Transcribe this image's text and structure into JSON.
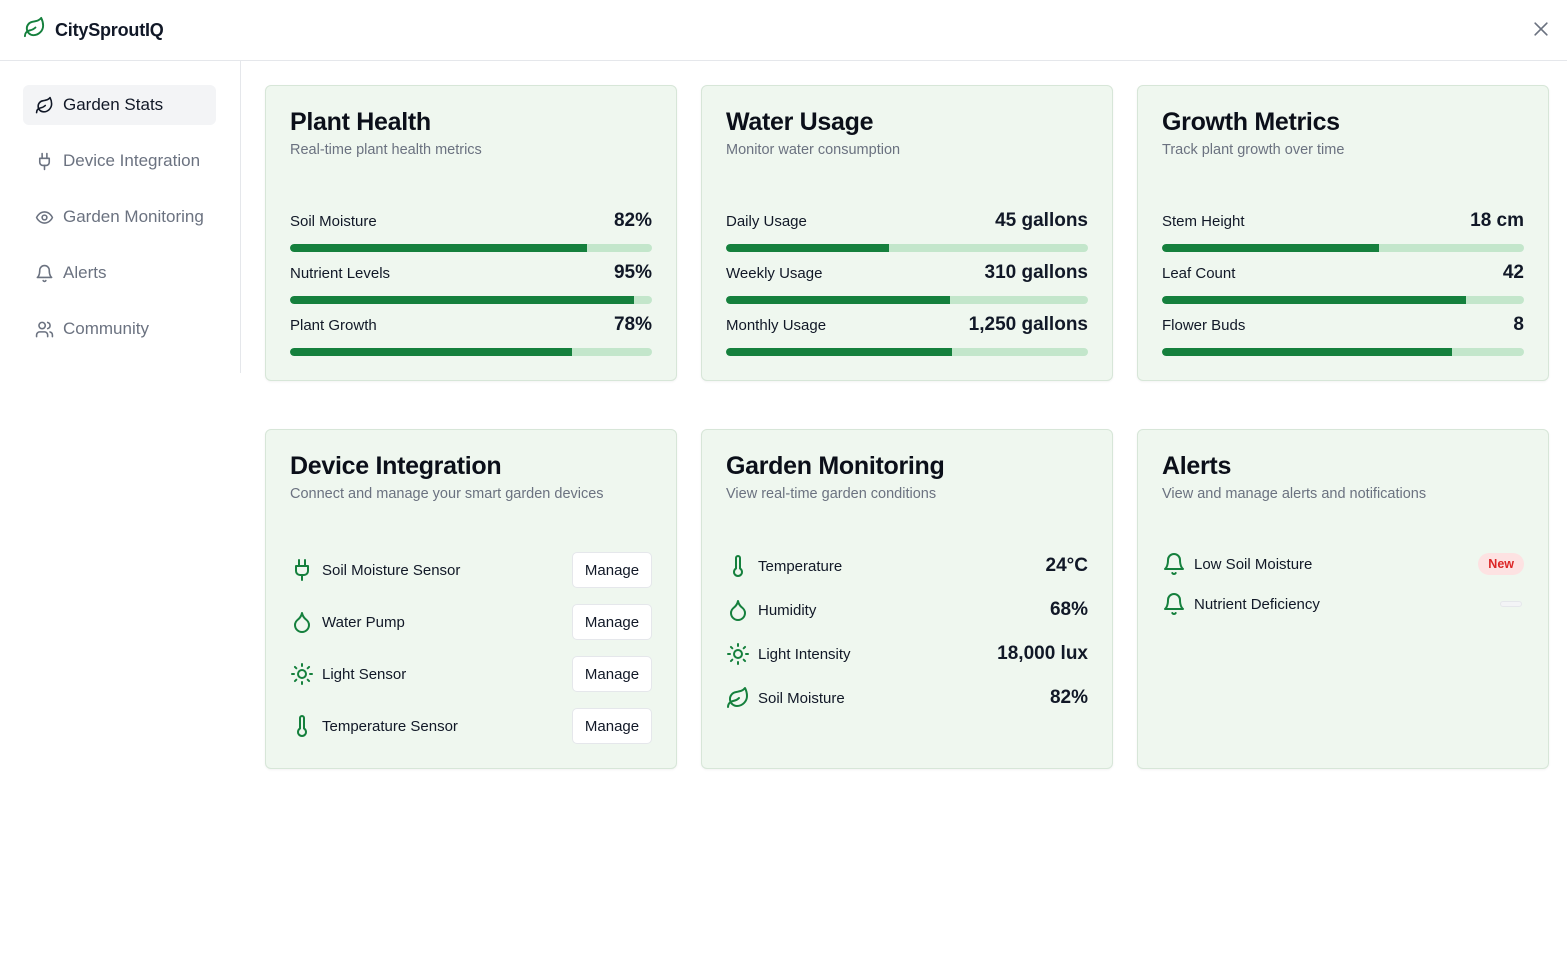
{
  "app": {
    "name": "CitySproutIQ",
    "accent": "#15803d"
  },
  "sidebar": {
    "items": [
      {
        "label": "Garden Stats",
        "icon": "leaf-icon",
        "active": true
      },
      {
        "label": "Device Integration",
        "icon": "plug-icon",
        "active": false
      },
      {
        "label": "Garden Monitoring",
        "icon": "eye-icon",
        "active": false
      },
      {
        "label": "Alerts",
        "icon": "bell-icon",
        "active": false
      },
      {
        "label": "Community",
        "icon": "users-icon",
        "active": false
      }
    ]
  },
  "plant_health": {
    "title": "Plant Health",
    "subtitle": "Real-time plant health metrics",
    "metrics": [
      {
        "label": "Soil Moisture",
        "value": "82%",
        "progress": 0.82
      },
      {
        "label": "Nutrient Levels",
        "value": "95%",
        "progress": 0.95
      },
      {
        "label": "Plant Growth",
        "value": "78%",
        "progress": 0.78
      }
    ]
  },
  "water_usage": {
    "title": "Water Usage",
    "subtitle": "Monitor water consumption",
    "metrics": [
      {
        "label": "Daily Usage",
        "value": "45 gallons",
        "progress": 0.45
      },
      {
        "label": "Weekly Usage",
        "value": "310 gallons",
        "progress": 0.62
      },
      {
        "label": "Monthly Usage",
        "value": "1,250 gallons",
        "progress": 0.625
      }
    ]
  },
  "growth_metrics": {
    "title": "Growth Metrics",
    "subtitle": "Track plant growth over time",
    "metrics": [
      {
        "label": "Stem Height",
        "value": "18 cm",
        "progress": 0.6
      },
      {
        "label": "Leaf Count",
        "value": "42",
        "progress": 0.84
      },
      {
        "label": "Flower Buds",
        "value": "8",
        "progress": 0.8
      }
    ]
  },
  "device_integration": {
    "title": "Device Integration",
    "subtitle": "Connect and manage your smart garden devices",
    "devices": [
      {
        "name": "Soil Moisture Sensor",
        "icon": "plug-icon",
        "action": "Manage"
      },
      {
        "name": "Water Pump",
        "icon": "droplet-icon",
        "action": "Manage"
      },
      {
        "name": "Light Sensor",
        "icon": "sun-icon",
        "action": "Manage"
      },
      {
        "name": "Temperature Sensor",
        "icon": "thermometer-icon",
        "action": "Manage"
      }
    ]
  },
  "garden_monitoring": {
    "title": "Garden Monitoring",
    "subtitle": "View real-time garden conditions",
    "readings": [
      {
        "name": "Temperature",
        "icon": "thermometer-icon",
        "value": "24°C"
      },
      {
        "name": "Humidity",
        "icon": "droplet-icon",
        "value": "68%"
      },
      {
        "name": "Light Intensity",
        "icon": "sun-icon",
        "value": "18,000 lux"
      },
      {
        "name": "Soil Moisture",
        "icon": "leaf-icon",
        "value": "82%"
      }
    ]
  },
  "alerts": {
    "title": "Alerts",
    "subtitle": "View and manage alerts and notifications",
    "items": [
      {
        "name": "Low Soil Moisture",
        "icon": "bell-icon",
        "badge": "New"
      },
      {
        "name": "Nutrient Deficiency",
        "icon": "bell-icon",
        "badge": ""
      }
    ]
  }
}
